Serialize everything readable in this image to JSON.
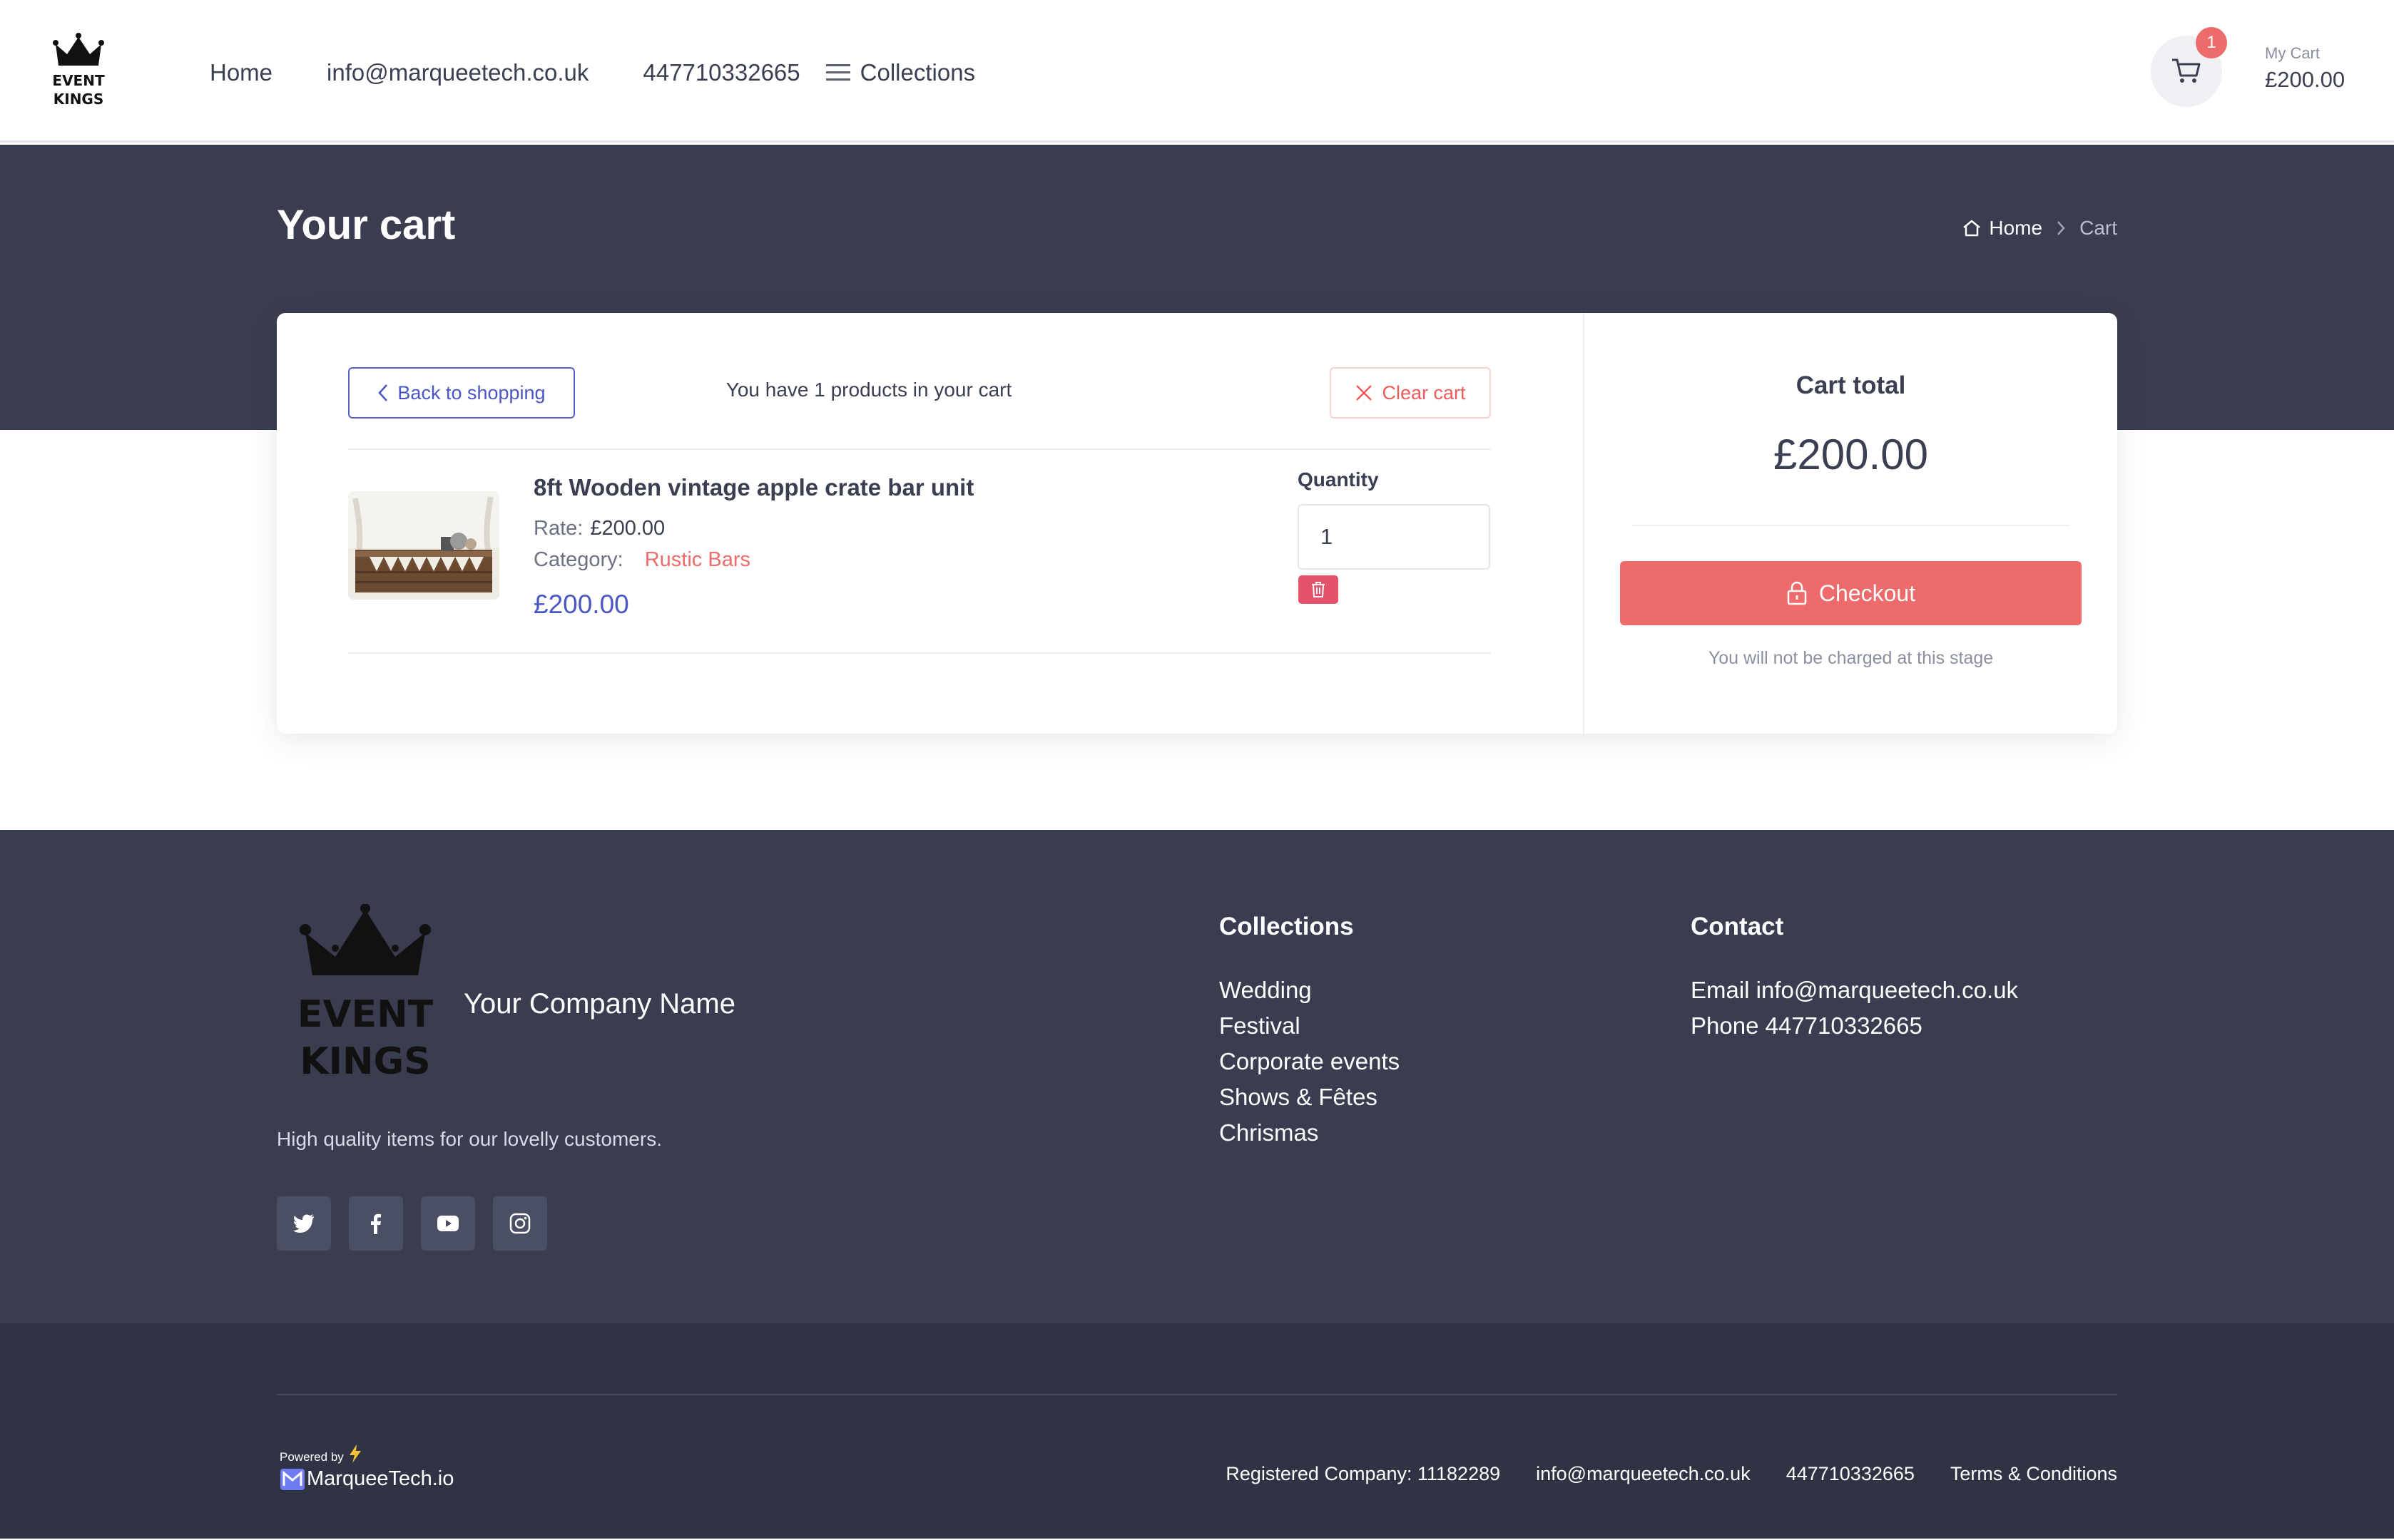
{
  "brand": {
    "logo_line1": "EVENT",
    "logo_line2": "KINGS"
  },
  "nav": {
    "home": "Home",
    "email": "info@marqueetech.co.uk",
    "phone": "447710332665",
    "collections": "Collections"
  },
  "cart_summary": {
    "count": "1",
    "label": "My Cart",
    "total": "£200.00"
  },
  "page": {
    "title": "Your cart"
  },
  "breadcrumb": {
    "home": "Home",
    "current": "Cart"
  },
  "cart": {
    "back_label": "Back to shopping",
    "count_text": "You have 1 products in your cart",
    "clear_label": "Clear cart",
    "items": [
      {
        "name": "8ft Wooden vintage apple crate bar unit",
        "rate_label": "Rate:",
        "rate": "£200.00",
        "category_label": "Category:",
        "category": "Rustic Bars",
        "price": "£200.00",
        "quantity_label": "Quantity",
        "quantity": "1"
      }
    ]
  },
  "total": {
    "title": "Cart total",
    "value": "£200.00",
    "checkout_label": "Checkout",
    "note": "You will not be charged at this stage"
  },
  "footer": {
    "company": "Your Company Name",
    "tagline": "High quality items for our lovelly customers.",
    "socials": [
      "twitter-icon",
      "facebook-icon",
      "youtube-icon",
      "instagram-icon"
    ],
    "collections_title": "Collections",
    "collections": [
      "Wedding",
      "Festival",
      "Corporate events",
      "Shows & Fêtes",
      "Chrismas"
    ],
    "contact_title": "Contact",
    "contact_email": "Email info@marqueetech.co.uk",
    "contact_phone": "Phone 447710332665"
  },
  "bottom": {
    "powered_by": "Powered by",
    "powered_brand": "MarqueeTech.io",
    "registered": "Registered Company: 11182289",
    "email": "info@marqueetech.co.uk",
    "phone": "447710332665",
    "terms": "Terms & Conditions"
  },
  "colors": {
    "dark": "#393d4f",
    "darker": "#2f3344",
    "accent_red": "#ee6b6b",
    "accent_blue": "#4a56c4",
    "text": "#3a3f51"
  }
}
